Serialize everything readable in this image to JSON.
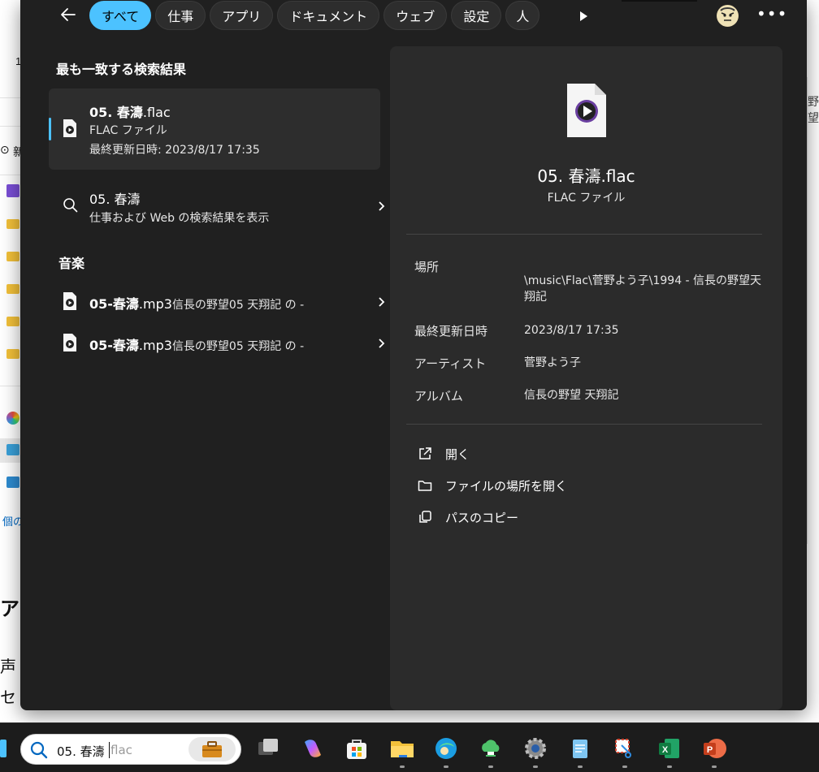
{
  "tabs": [
    {
      "label": "すべて",
      "active": true
    },
    {
      "label": "仕事"
    },
    {
      "label": "アプリ"
    },
    {
      "label": "ドキュメント"
    },
    {
      "label": "ウェブ"
    },
    {
      "label": "設定"
    },
    {
      "label": "人"
    }
  ],
  "best_match": {
    "section_title": "最も一致する検索結果",
    "title_bold": "05. 春濤",
    "title_rest": ".flac",
    "type": "FLAC ファイル",
    "modified": "最終更新日時: 2023/8/17 17:35"
  },
  "web_result": {
    "title": "05. 春濤",
    "subtitle": "仕事および Web の検索結果を表示"
  },
  "music": {
    "section_title": "音楽",
    "items": [
      {
        "bold": "05-春濤",
        "ext": ".mp3",
        "rest": "信長の野望05 天翔記 の -"
      },
      {
        "bold": "05-春濤",
        "ext": ".mp3",
        "rest": "信長の野望05 天翔記 の -"
      }
    ]
  },
  "preview": {
    "name": "05. 春濤.flac",
    "type": "FLAC ファイル",
    "meta": [
      {
        "label": "場所",
        "value": "\\music\\Flac\\菅野よう子\\1994 - 信長の野望天翔記"
      },
      {
        "label": "最終更新日時",
        "value": "2023/8/17 17:35"
      },
      {
        "label": "アーティスト",
        "value": "菅野よう子"
      },
      {
        "label": "アルバム",
        "value": "信長の野望 天翔記"
      }
    ],
    "actions": [
      {
        "label": "開く",
        "icon": "open-external-icon"
      },
      {
        "label": "ファイルの場所を開く",
        "icon": "folder-icon"
      },
      {
        "label": "パスのコピー",
        "icon": "copy-icon"
      }
    ]
  },
  "taskbar": {
    "search_value": "05. 春濤",
    "search_placeholder": "flac"
  },
  "background": {
    "snippets": [
      "1",
      "新",
      "個の",
      "声",
      "セ",
      "野望"
    ]
  },
  "colors": {
    "accent": "#4cc2ff",
    "panel": "#202020",
    "preview": "#2b2b2b",
    "card": "#2d2d2d"
  }
}
